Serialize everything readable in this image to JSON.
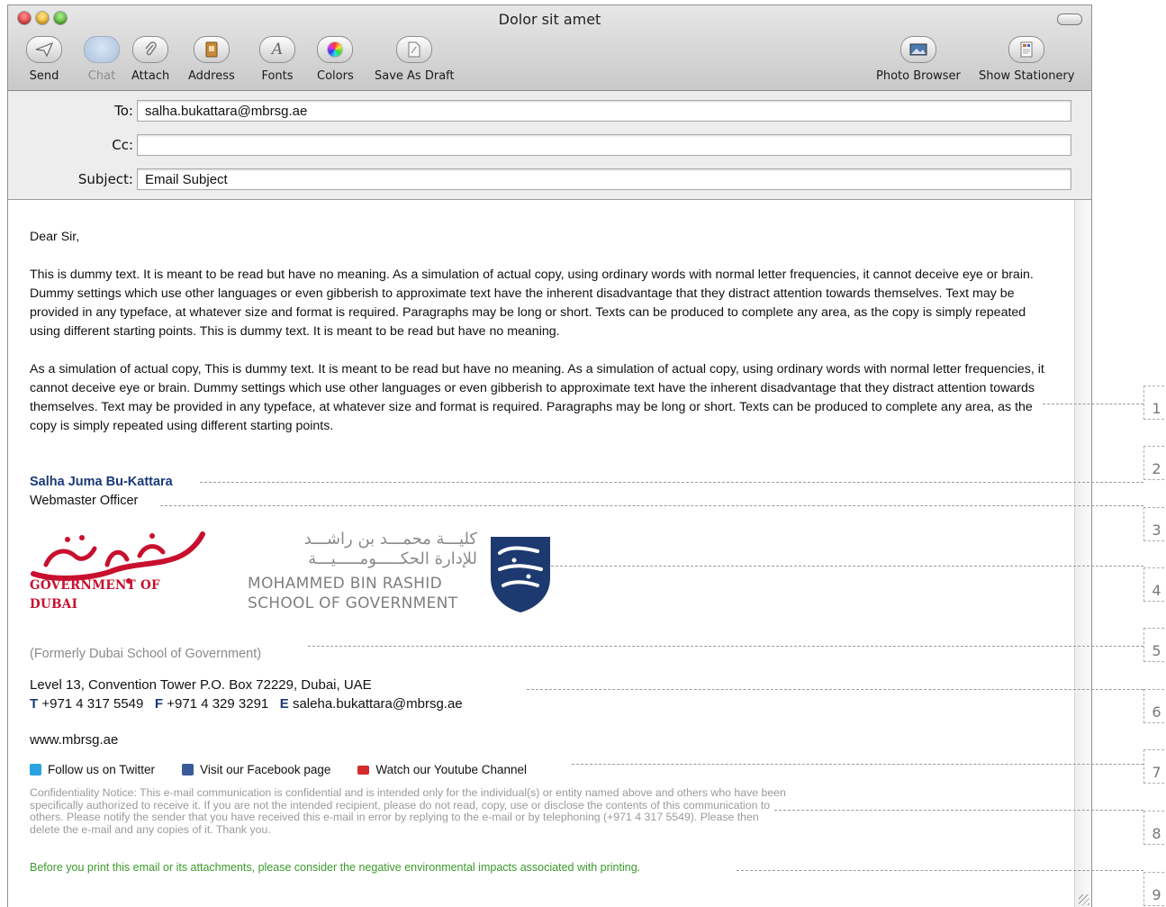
{
  "window": {
    "title": "Dolor sit amet"
  },
  "toolbar": {
    "send": "Send",
    "chat": "Chat",
    "attach": "Attach",
    "address": "Address",
    "fonts": "Fonts",
    "colors": "Colors",
    "save_draft": "Save As Draft",
    "photo_browser": "Photo Browser",
    "show_stationery": "Show Stationery"
  },
  "headers": {
    "to_label": "To:",
    "to_value": "salha.bukattara@mbrsg.ae",
    "cc_label": "Cc:",
    "cc_value": "",
    "subject_label": "Subject:",
    "subject_value": "Email Subject"
  },
  "body": {
    "greeting": "Dear Sir,",
    "paragraph1": "This is dummy text. It is meant to be read but have no meaning. As a simulation of actual copy, using ordinary words with normal letter frequencies, it cannot deceive eye or brain. Dummy settings which use other languages or even gibberish to approximate text have the inherent disadvantage that they distract attention towards themselves. Text may be provided in any typeface, at whatever size and format is required. Paragraphs may be long or short. Texts can be produced to complete any area, as the copy is simply repeated using different starting points. This is dummy text. It is meant to be read but have no meaning.",
    "paragraph2": "As a simulation of actual copy, This is dummy text. It is meant to be read but have no meaning. As a simulation of actual copy, using ordinary words with normal letter frequencies, it cannot deceive eye or brain. Dummy settings which use other languages or even gibberish to approximate text have the inherent disadvantage that they distract attention towards themselves. Text may be provided in any typeface, at whatever size and format is required. Paragraphs may be long or short. Texts can be produced to complete any area, as the copy is simply repeated using different starting points."
  },
  "signature": {
    "name": "Salha Juma Bu-Kattara",
    "role": "Webmaster Officer",
    "dubai_logo_text": "GOVERNMENT OF DUBAI",
    "mbr_arabic_line1": "كليـــة محمـــد بن راشـــد",
    "mbr_arabic_line2": "للإدارة الحكـــــومـــــيـــة",
    "mbr_english_line1": "MOHAMMED BIN RASHID",
    "mbr_english_line2": "SCHOOL OF GOVERNMENT",
    "formerly": "(Formerly Dubai School of Government)",
    "address": "Level 13, Convention Tower  P.O. Box 72229, Dubai, UAE",
    "tel_label": "T",
    "tel": "+971 4 317 5549",
    "fax_label": "F",
    "fax": "+971 4 329 3291",
    "email_label": "E",
    "email": "saleha.bukattara@mbrsg.ae",
    "website": "www.mbrsg.ae",
    "twitter": "Follow us on Twitter",
    "facebook": "Visit our Facebook page",
    "youtube": "Watch our Youtube Channel",
    "confidentiality": "Confidentiality Notice: This e-mail communication is confidential and is intended only for the individual(s) or entity named above and others who have been specifically authorized to receive it. If you are not the intended recipient, please do not read, copy, use or disclose the contents of this communication to others. Please notify the sender that you have received this e-mail in error by replying to the e-mail or by telephoning (+971 4 317 5549). Please then delete the e-mail and any copies of it. Thank you.",
    "eco_note": "Before you print this email or its attachments, please consider the negative environmental impacts associated with printing."
  },
  "annotations": [
    "1",
    "2",
    "3",
    "4",
    "5",
    "6",
    "7",
    "8",
    "9"
  ],
  "colors": {
    "name_blue": "#1a3a7a",
    "dubai_red": "#c8102e",
    "eco_green": "#3a9a2a",
    "mbr_navy": "#1d3a70"
  }
}
